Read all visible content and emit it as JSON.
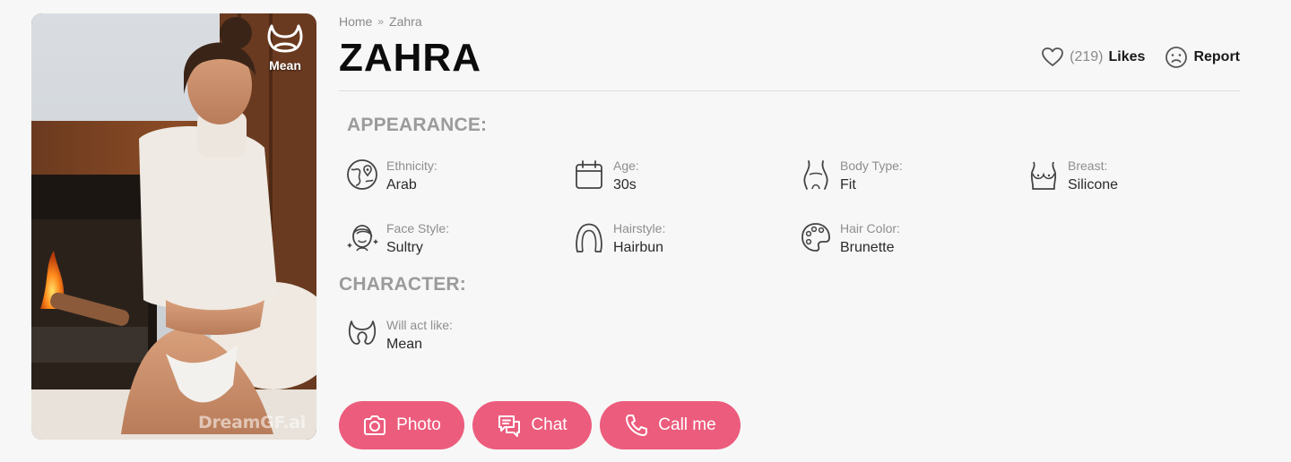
{
  "profile": {
    "badge_label": "Mean",
    "watermark": "DreamGF.ai"
  },
  "breadcrumb": {
    "home": "Home",
    "separator": "»",
    "current": "Zahra"
  },
  "title": "ZAHRA",
  "actions": {
    "likes_count": "(219)",
    "likes_label": "Likes",
    "report_label": "Report"
  },
  "appearance": {
    "heading": "APPEARANCE:",
    "items": [
      {
        "label": "Ethnicity:",
        "value": "Arab",
        "icon": "globe-pin-icon"
      },
      {
        "label": "Age:",
        "value": "30s",
        "icon": "calendar-icon"
      },
      {
        "label": "Body Type:",
        "value": "Fit",
        "icon": "body-torso-icon"
      },
      {
        "label": "Breast:",
        "value": "Silicone",
        "icon": "breast-icon"
      },
      {
        "label": "Face Style:",
        "value": "Sultry",
        "icon": "face-sparkle-icon"
      },
      {
        "label": "Hairstyle:",
        "value": "Hairbun",
        "icon": "hair-icon"
      },
      {
        "label": "Hair Color:",
        "value": "Brunette",
        "icon": "palette-icon"
      }
    ]
  },
  "character": {
    "heading": "CHARACTER:",
    "items": [
      {
        "label": "Will act like:",
        "value": "Mean",
        "icon": "devil-horns-icon"
      }
    ]
  },
  "buttons": {
    "photo": "Photo",
    "chat": "Chat",
    "call": "Call me"
  },
  "colors": {
    "accent": "#ec5c7d",
    "background": "#f7f7f7",
    "section_heading": "#9b9b9b"
  }
}
